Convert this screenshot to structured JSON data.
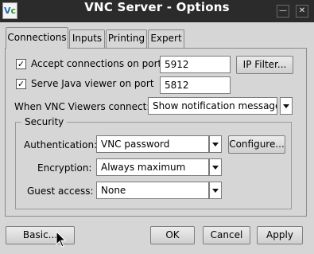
{
  "window": {
    "title": "VNC Server - Options",
    "app_icon": "vnc-app-icon",
    "app_icon_letters": [
      "V",
      "c"
    ],
    "minimize_glyph": "—",
    "close_glyph": "✕"
  },
  "tabs": [
    {
      "label": "Connections",
      "active": true
    },
    {
      "label": "Inputs",
      "active": false
    },
    {
      "label": "Printing",
      "active": false
    },
    {
      "label": "Expert",
      "active": false
    }
  ],
  "connections": {
    "accept_port": {
      "checked": true,
      "label": "Accept connections on port",
      "value": "5912"
    },
    "ip_filter_label": "IP Filter...",
    "java_viewer": {
      "checked": true,
      "label": "Serve Java viewer on port",
      "value": "5812"
    },
    "when_connect_label": "When VNC Viewers connect:",
    "when_connect_value": "Show notification message",
    "check_mark": "✓"
  },
  "security": {
    "title": "Security",
    "authentication_label": "Authentication:",
    "authentication_value": "VNC password",
    "configure_label": "Configure...",
    "encryption_label": "Encryption:",
    "encryption_value": "Always maximum",
    "guest_access_label": "Guest access:",
    "guest_access_value": "None"
  },
  "footer": {
    "basic_label": "Basic...",
    "ok_label": "OK",
    "cancel_label": "Cancel",
    "apply_label": "Apply"
  }
}
